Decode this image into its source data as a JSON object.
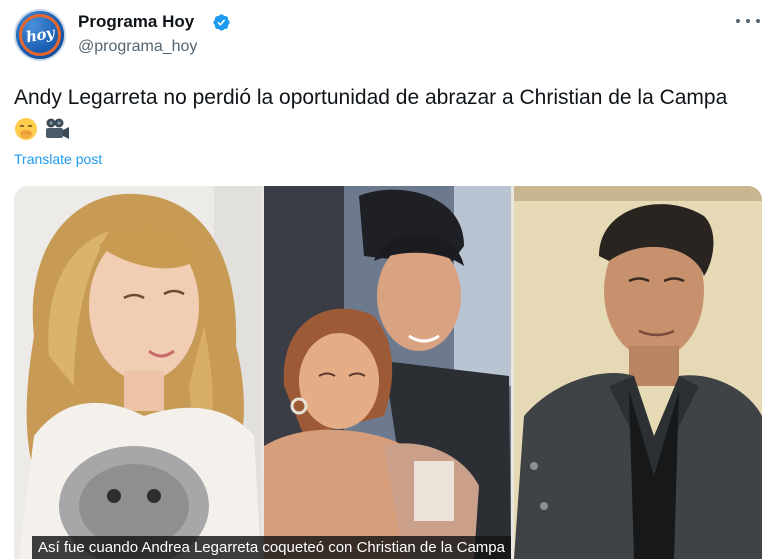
{
  "account": {
    "display_name": "Programa Hoy",
    "handle": "@programa_hoy",
    "avatar_logo": "hoy",
    "verified_color": "#1d9bf0"
  },
  "post": {
    "text_main": "Andy Legarreta no perdió la oportunidad de abrazar a Christian de la Campa",
    "emojis": [
      "face-with-hand-over-mouth-emoji",
      "movie-camera-emoji"
    ],
    "translate_label": "Translate post",
    "link_color": "#1d9bf0"
  },
  "media": {
    "images": [
      {
        "name": "photo-woman-portrait"
      },
      {
        "name": "photo-couple-hug"
      },
      {
        "name": "photo-man-portrait"
      }
    ],
    "caption": "Así fue cuando Andrea Legarreta coqueteó con Christian de la Campa"
  },
  "icons": {
    "more": "more-options-icon",
    "verified": "verified-badge-icon"
  }
}
